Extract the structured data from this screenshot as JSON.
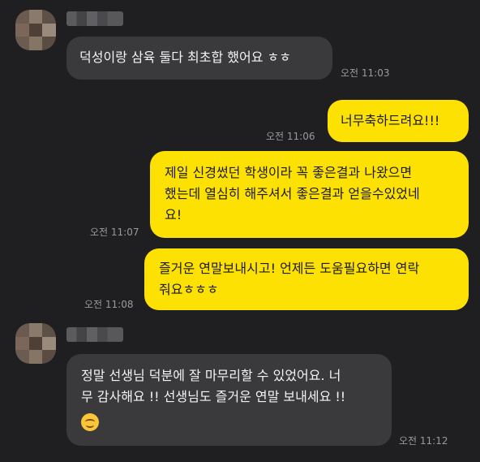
{
  "messages": [
    {
      "side": "in",
      "text": "덕성이랑 삼육 둘다 최초합 했어요 ㅎㅎ",
      "time": "오전 11:03"
    },
    {
      "side": "out",
      "text": "너무축하드려요!!!",
      "time": "오전 11:06"
    },
    {
      "side": "out",
      "lines": [
        "제일 신경썼던 학생이라 꼭 좋은결과 나왔으면",
        "했는데 열심히 해주셔서 좋은결과 얻을수있었네",
        "요!"
      ],
      "time": "오전 11:07"
    },
    {
      "side": "out",
      "lines": [
        "즐거운 연말보내시고! 언제든 도움필요하면 연락",
        "줘요ㅎㅎㅎ"
      ],
      "time": "오전 11:08"
    },
    {
      "side": "in",
      "lines": [
        "정말 선생님 덕분에 잘 마무리할 수 있었어요. 너",
        "무 감사해요 !! 선생님도 즐거운 연말 보내세요 !!"
      ],
      "emoji": "smiling-face-icon",
      "time": "오전 11:12"
    }
  ],
  "colors": {
    "background": "#1f1f21",
    "incoming_bubble": "#3a3a3c",
    "outgoing_bubble": "#fde102"
  }
}
